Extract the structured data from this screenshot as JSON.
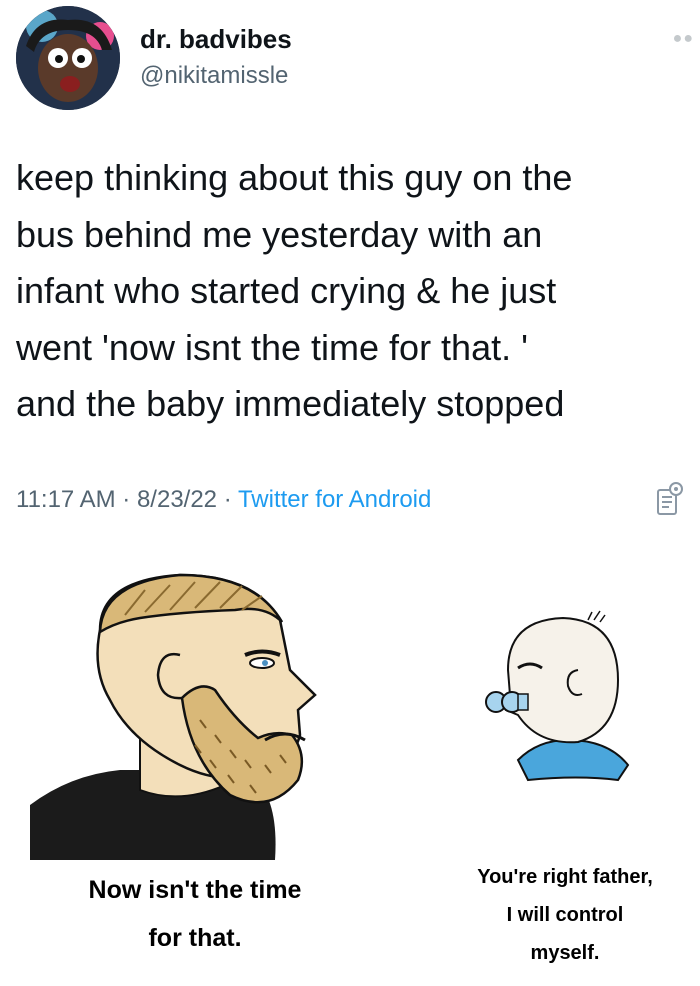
{
  "tweet": {
    "author": {
      "display_name": "dr. badvibes",
      "handle": "@nikitamissle"
    },
    "text_lines": [
      "keep thinking about this guy on the",
      "bus behind me yesterday with an",
      "infant who started crying & he just",
      "went 'now isnt the time for that. '",
      "and the baby immediately stopped"
    ],
    "time": "11:17 AM",
    "date": "8/23/22",
    "source": "Twitter for Android",
    "separator": " · "
  },
  "meme": {
    "left_caption": [
      "Now isn't the time",
      "for that."
    ],
    "right_caption": [
      "You're right father,",
      "I will control",
      "myself."
    ]
  },
  "icons": {
    "more": "more-options-icon",
    "analytics": "analytics-icon"
  },
  "colors": {
    "text": "#0f1419",
    "secondary": "#536471",
    "link": "#1d9bf0",
    "beard": "#d9b878",
    "skin": "#f3dfba",
    "shirt_dark": "#1b1b1b",
    "shirt_blue": "#4aa6dc"
  }
}
